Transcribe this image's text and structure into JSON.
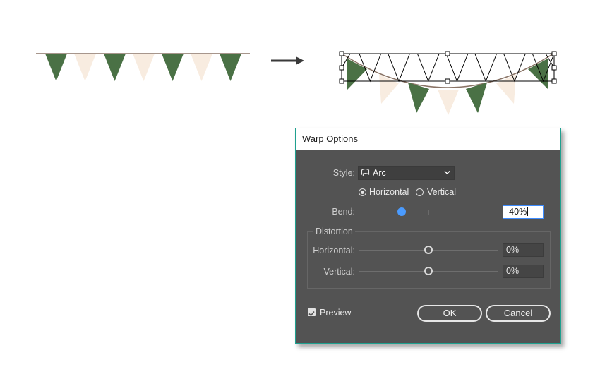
{
  "illustration": {
    "colors": {
      "flag_green": "#4a7145",
      "flag_cream": "#f8ece0",
      "string": "#8a7466",
      "arrow": "#3a3a3a",
      "selection": "#000000"
    },
    "flag_sequence": [
      "green",
      "cream",
      "green",
      "cream",
      "green",
      "cream",
      "green"
    ]
  },
  "dialog": {
    "title": "Warp Options",
    "style_label": "Style:",
    "style_value": "Arc",
    "style_icon": "arc-warp-icon",
    "orientation": {
      "horizontal_label": "Horizontal",
      "vertical_label": "Vertical",
      "selected": "Horizontal"
    },
    "bend": {
      "label": "Bend:",
      "value": "-40%",
      "level_percent": -40
    },
    "distortion": {
      "group_title": "Distortion",
      "horizontal": {
        "label": "Horizontal:",
        "value": "0%",
        "level_percent": 0
      },
      "vertical": {
        "label": "Vertical:",
        "value": "0%",
        "level_percent": 0
      }
    },
    "preview": {
      "label": "Preview",
      "checked": true
    },
    "ok_label": "OK",
    "cancel_label": "Cancel",
    "accent_color": "#4a9bff",
    "border_color": "#1fa08f"
  }
}
